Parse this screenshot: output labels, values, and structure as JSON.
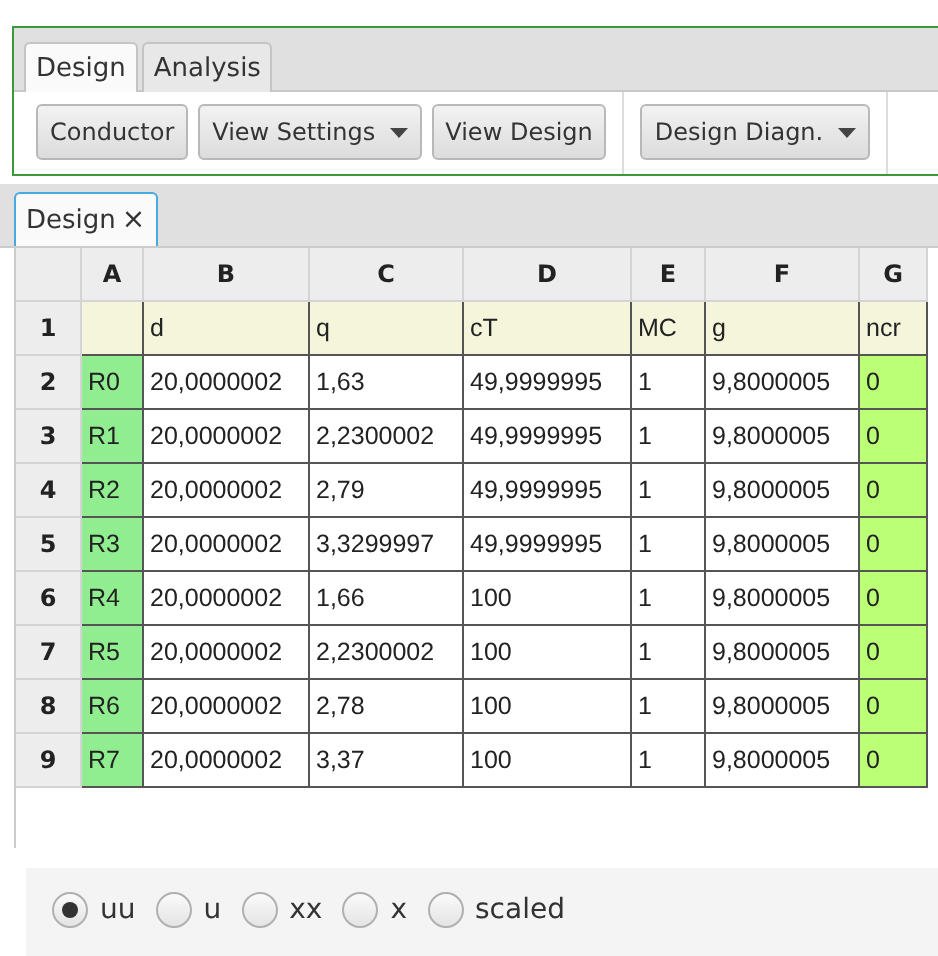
{
  "ribbon_tabs": [
    {
      "label": "Design",
      "selected": true
    },
    {
      "label": "Analysis",
      "selected": false
    }
  ],
  "toolbar": {
    "groups": [
      [
        {
          "label": "Conductor",
          "dropdown": false
        },
        {
          "label": "View Settings",
          "dropdown": true
        },
        {
          "label": "View Design",
          "dropdown": false
        }
      ],
      [
        {
          "label": "Design Diagn.",
          "dropdown": true
        }
      ]
    ]
  },
  "document_tabs": [
    {
      "label": "Design",
      "close": "×",
      "selected": true
    }
  ],
  "sheet": {
    "columns": [
      "A",
      "B",
      "C",
      "D",
      "E",
      "F",
      "G"
    ],
    "rows": [
      {
        "number": "1",
        "cells": [
          "",
          "d",
          "q",
          "cT",
          "MC",
          "g",
          "ncr"
        ]
      },
      {
        "number": "2",
        "cells": [
          "R0",
          "20,0000002",
          "1,63",
          "49,9999995",
          "1",
          "9,8000005",
          "0"
        ]
      },
      {
        "number": "3",
        "cells": [
          "R1",
          "20,0000002",
          "2,2300002",
          "49,9999995",
          "1",
          "9,8000005",
          "0"
        ]
      },
      {
        "number": "4",
        "cells": [
          "R2",
          "20,0000002",
          "2,79",
          "49,9999995",
          "1",
          "9,8000005",
          "0"
        ]
      },
      {
        "number": "5",
        "cells": [
          "R3",
          "20,0000002",
          "3,3299997",
          "49,9999995",
          "1",
          "9,8000005",
          "0"
        ]
      },
      {
        "number": "6",
        "cells": [
          "R4",
          "20,0000002",
          "1,66",
          "100",
          "1",
          "9,8000005",
          "0"
        ]
      },
      {
        "number": "7",
        "cells": [
          "R5",
          "20,0000002",
          "2,2300002",
          "100",
          "1",
          "9,8000005",
          "0"
        ]
      },
      {
        "number": "8",
        "cells": [
          "R6",
          "20,0000002",
          "2,78",
          "100",
          "1",
          "9,8000005",
          "0"
        ]
      },
      {
        "number": "9",
        "cells": [
          "R7",
          "20,0000002",
          "3,37",
          "100",
          "1",
          "9,8000005",
          "0"
        ]
      }
    ]
  },
  "radio_options": [
    {
      "label": "uu",
      "selected": true
    },
    {
      "label": "u",
      "selected": false
    },
    {
      "label": "xx",
      "selected": false
    },
    {
      "label": "x",
      "selected": false
    },
    {
      "label": "scaled",
      "selected": false
    }
  ]
}
